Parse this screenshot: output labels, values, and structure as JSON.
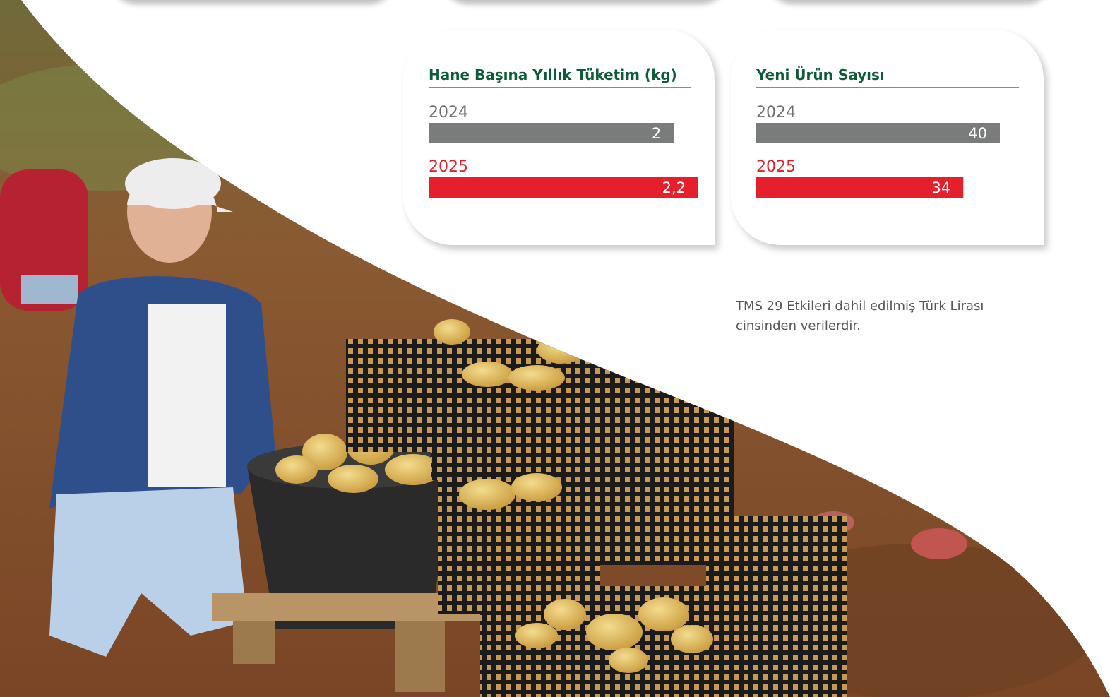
{
  "colors": {
    "title_green": "#0c5c3a",
    "bar_2024": "#7a7b7b",
    "bar_2025": "#e51f2c",
    "label_2024": "#6e6e6e",
    "label_2025": "#e51f2c"
  },
  "chart_data": [
    {
      "type": "bar",
      "orientation": "horizontal",
      "title": "Hane Başına Yıllık Tüketim (kg)",
      "categories": [
        "2024",
        "2025"
      ],
      "values": [
        2,
        2.2
      ],
      "value_labels": [
        "2",
        "2,2"
      ],
      "xlim": [
        0,
        2.2
      ],
      "grid": false,
      "legend": "none"
    },
    {
      "type": "bar",
      "orientation": "horizontal",
      "title": "Yeni Ürün Sayısı",
      "categories": [
        "2024",
        "2025"
      ],
      "values": [
        40,
        34
      ],
      "value_labels": [
        "40",
        "34"
      ],
      "xlim": [
        0,
        40
      ],
      "grid": false,
      "legend": "none"
    }
  ],
  "footnote": "TMS 29 Etkileri dahil edilmiş Türk Lirası cinsinden verilerdir."
}
